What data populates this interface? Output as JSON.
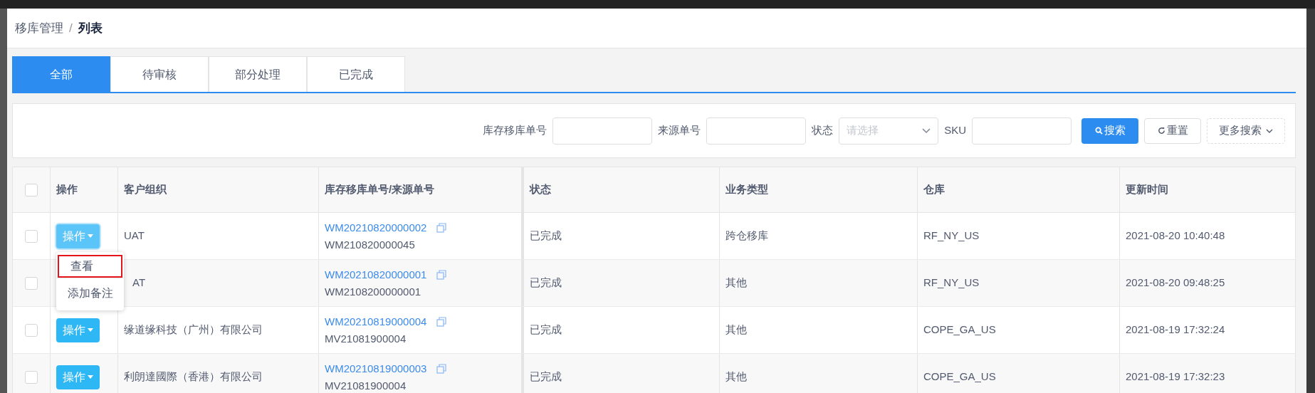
{
  "breadcrumb": [
    {
      "label": "移库管理",
      "current": false
    },
    {
      "label": "列表",
      "current": true
    }
  ],
  "breadcrumb_separator": "/",
  "tabs": [
    {
      "label": "全部",
      "selected": true
    },
    {
      "label": "待审核",
      "selected": false
    },
    {
      "label": "部分处理",
      "selected": false
    },
    {
      "label": "已完成",
      "selected": false
    }
  ],
  "search": {
    "fields": [
      {
        "kind": "input",
        "label": "库存移库单号"
      },
      {
        "kind": "input",
        "label": "来源单号"
      },
      {
        "kind": "select",
        "label": "状态",
        "placeholder": "请选择"
      },
      {
        "kind": "input",
        "label": "SKU"
      }
    ],
    "buttons": [
      {
        "kind": "primary",
        "label": "搜索"
      },
      {
        "kind": "reset",
        "label": "重置"
      },
      {
        "kind": "more",
        "label": "更多搜索"
      }
    ]
  },
  "table": {
    "select_all": {
      "checked": false
    },
    "columns": [
      "操作",
      "客户组织",
      "库存移库单号/来源单号",
      "状态",
      "业务类型",
      "仓库",
      "更新时间"
    ],
    "rows": [
      {
        "checked": false,
        "action": {
          "label": "操作",
          "open": true
        },
        "customer": "UAT",
        "order_no": "WM20210820000002",
        "source_no": "WM210820000045",
        "status": "已完成",
        "business_type": "跨仓移库",
        "warehouse": "RF_NY_US",
        "updated": "2021-08-20 10:40:48"
      },
      {
        "checked": false,
        "customer": "AT",
        "order_no": "WM20210820000001",
        "source_no": "WM2108200000001",
        "status": "已完成",
        "business_type": "其他",
        "warehouse": "RF_NY_US",
        "updated": "2021-08-20 09:48:25"
      },
      {
        "checked": false,
        "action": {
          "label": "操作",
          "open": false
        },
        "customer": "缘道缘科技（广州）有限公司",
        "order_no": "WM20210819000004",
        "source_no": "MV21081900004",
        "status": "已完成",
        "business_type": "其他",
        "warehouse": "COPE_GA_US",
        "updated": "2021-08-19 17:32:24"
      },
      {
        "checked": false,
        "action": {
          "label": "操作",
          "open": false
        },
        "customer": "利朗達國際（香港）有限公司",
        "order_no": "WM20210819000003",
        "source_no": "MV21081900004",
        "status": "已完成",
        "business_type": "其他",
        "warehouse": "COPE_GA_US",
        "updated": "2021-08-19 17:32:23"
      }
    ]
  },
  "action_menu": [
    {
      "label": "查看",
      "highlighted": true
    },
    {
      "label": "添加备注",
      "highlighted": false
    }
  ]
}
